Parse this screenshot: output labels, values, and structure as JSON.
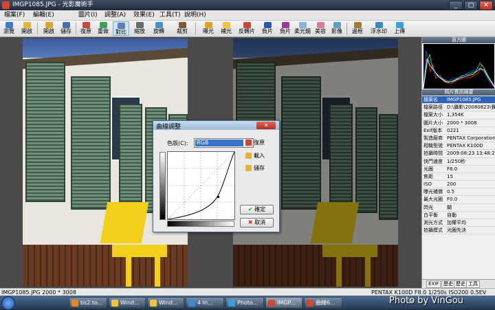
{
  "window": {
    "title": "IMGP1085.JPG - 光影魔術手",
    "controls": [
      "_",
      "□",
      "✕"
    ]
  },
  "menu": {
    "items": [
      "檔案(F)",
      "編輯(E)",
      "圖片(I)",
      "調整(A)",
      "效果(E)",
      "工具(T)",
      "說明(H)"
    ]
  },
  "toolbar": {
    "buttons": [
      {
        "label": "瀏覽",
        "icon": "browse-icon",
        "color": "#3f7cc8"
      },
      {
        "label": "開啟",
        "icon": "open-icon",
        "color": "#e0b53a"
      },
      {
        "label": "開啟",
        "icon": "open-folder-icon",
        "color": "#d9a52c"
      },
      {
        "label": "儲存",
        "icon": "save-icon",
        "color": "#4a6fa8"
      },
      {
        "label": "復原",
        "icon": "undo-icon",
        "color": "#c24a3a"
      },
      {
        "label": "重做",
        "icon": "redo-icon",
        "color": "#3aa05a"
      },
      {
        "label": "對比",
        "icon": "compare-icon",
        "color": "#5a7ec0"
      },
      {
        "label": "縮放",
        "icon": "zoom-icon",
        "color": "#6a6a6a"
      },
      {
        "label": "旋轉",
        "icon": "rotate-icon",
        "color": "#4a90c8"
      },
      {
        "label": "裁剪",
        "icon": "crop-icon",
        "color": "#7a5a3a"
      },
      {
        "label": "曝光",
        "icon": "exposure-icon",
        "color": "#e3a21f"
      },
      {
        "label": "補光",
        "icon": "fill-light-icon",
        "color": "#f0c43a"
      },
      {
        "label": "反轉片",
        "icon": "reversal-film-icon",
        "color": "#c8463a"
      },
      {
        "label": "負片",
        "icon": "negative-icon",
        "color": "#2f5aa0"
      },
      {
        "label": "負片",
        "icon": "negative-film-icon",
        "color": "#9a3a9a"
      },
      {
        "label": "柔光鏡",
        "icon": "soft-filter-icon",
        "color": "#8ab0d8"
      },
      {
        "label": "美容",
        "icon": "beauty-icon",
        "color": "#e07a9a"
      },
      {
        "label": "影像",
        "icon": "image-icon",
        "color": "#5aa0c8"
      },
      {
        "label": "邊框",
        "icon": "frame-icon",
        "color": "#a07a3a"
      },
      {
        "label": "浮水印",
        "icon": "watermark-icon",
        "color": "#3a8ac0"
      },
      {
        "label": "上傳",
        "icon": "upload-icon",
        "color": "#3aa0d8"
      }
    ]
  },
  "curves_dialog": {
    "title": "曲線調整",
    "close_label": "✕",
    "channel_label": "色版(C):",
    "channel_value": "RGB",
    "channel_arrow": "▼",
    "reset_label": "復原",
    "load_label": "載入",
    "save_label": "儲存",
    "ok_label": "確定",
    "cancel_label": "取消"
  },
  "right_panel": {
    "histogram_title": "直方圖",
    "info_title": "照片資訊摘要",
    "info": [
      {
        "key": "檔案名",
        "value": "IMGP1085.JPG"
      },
      {
        "key": "檔案路徑",
        "value": "D:\\攝影\\20080823\\賽安港"
      },
      {
        "key": "檔案大小",
        "value": "1,354K"
      },
      {
        "key": "圖片大小",
        "value": "2000 * 3008"
      },
      {
        "key": "Exif版本",
        "value": "0221"
      },
      {
        "key": "製造廠商",
        "value": "PENTAX Corporation"
      },
      {
        "key": "相機型號",
        "value": "PENTAX K100D"
      },
      {
        "key": "拍攝時間",
        "value": "2009:08:23 13:48:28"
      },
      {
        "key": "快門速度",
        "value": "1/250秒"
      },
      {
        "key": "光圈",
        "value": "F8.0"
      },
      {
        "key": "焦距",
        "value": "15"
      },
      {
        "key": "ISO",
        "value": "200"
      },
      {
        "key": "曝光補償",
        "value": "0.5"
      },
      {
        "key": "最大光圈",
        "value": "F0.0"
      },
      {
        "key": "閃光",
        "value": "關"
      },
      {
        "key": "白平衡",
        "value": "自動"
      },
      {
        "key": "測光方式",
        "value": "加權平均"
      },
      {
        "key": "拍攝模式",
        "value": "光圈先決"
      }
    ],
    "tabs": [
      "EXIF",
      "歷史",
      "歷史",
      "工具"
    ]
  },
  "status": {
    "left": "IMGP1085.JPG 2000 * 3008",
    "right": "PENTAX K100D F8.0 1/250s ISO200 0.5EV"
  },
  "taskbar": {
    "items": [
      {
        "label": "bs2.to...",
        "icon": "browser-icon",
        "color": "#e28a2a"
      },
      {
        "label": "Wind...",
        "icon": "explorer-icon",
        "color": "#f0c43a"
      },
      {
        "label": "Wind...",
        "icon": "explorer-icon",
        "color": "#f0c43a"
      },
      {
        "label": "4 In...",
        "icon": "ie-icon",
        "color": "#3a8ad8"
      },
      {
        "label": "Photo...",
        "icon": "photo-icon",
        "color": "#3aa0d8"
      },
      {
        "label": "IMGP...",
        "icon": "neoimaging-icon",
        "color": "#d9442c"
      },
      {
        "label": "曲線6...",
        "icon": "curves-icon",
        "color": "#d9442c"
      }
    ],
    "lang": "CH"
  },
  "watermark": "Photo by VinGou"
}
